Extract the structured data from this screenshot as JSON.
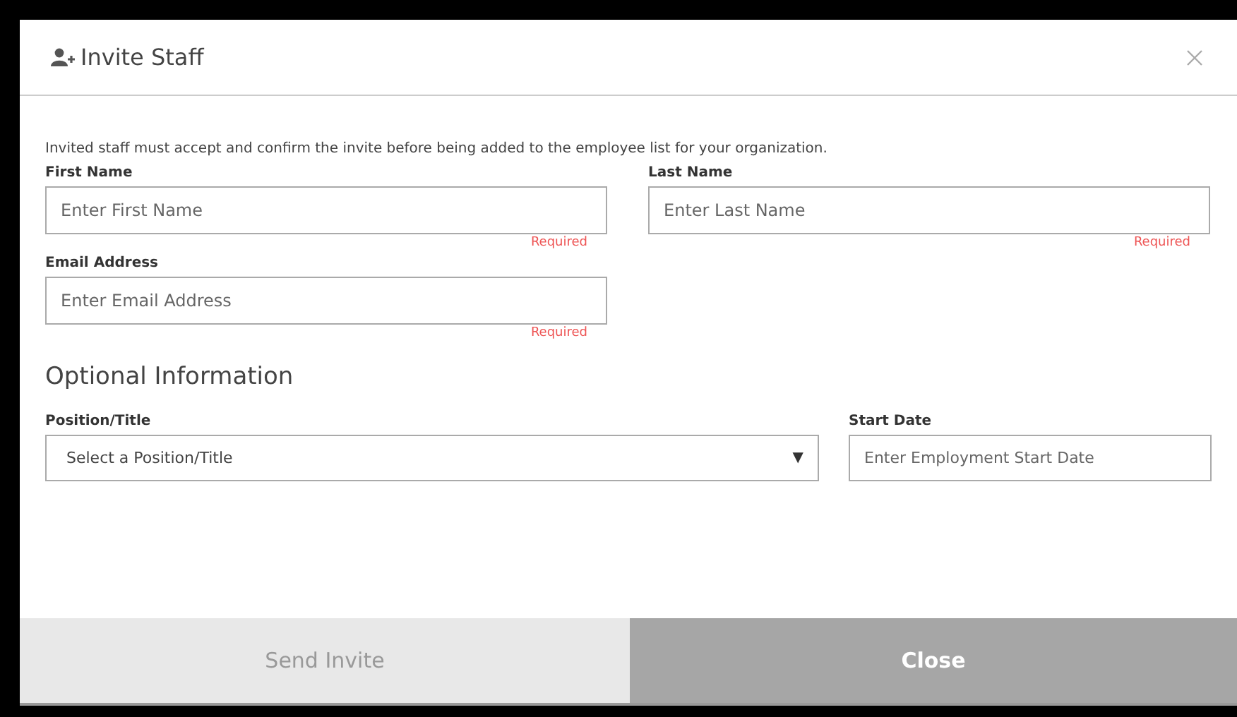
{
  "dialog": {
    "title": "Invite Staff",
    "intro": "Invited staff must accept and confirm the invite before being added to the employee list for your organization.",
    "fields": [
      {
        "label": "First Name",
        "placeholder": "Enter First Name",
        "hint": "Required"
      },
      {
        "label": "Last Name",
        "placeholder": "Enter Last Name",
        "hint": "Required"
      },
      {
        "label": "Email Address",
        "placeholder": "Enter Email Address",
        "hint": "Required"
      }
    ],
    "optional_heading": "Optional Information",
    "position": {
      "label": "Position/Title",
      "placeholder": "Select a Position/Title",
      "caret": "▼"
    },
    "start_date": {
      "label": "Start Date",
      "placeholder": "Enter Employment Start Date"
    },
    "buttons": [
      {
        "label": "Send Invite",
        "kind": "primary",
        "disabled": true
      },
      {
        "label": "Close",
        "kind": "secondary",
        "disabled": false
      }
    ]
  }
}
